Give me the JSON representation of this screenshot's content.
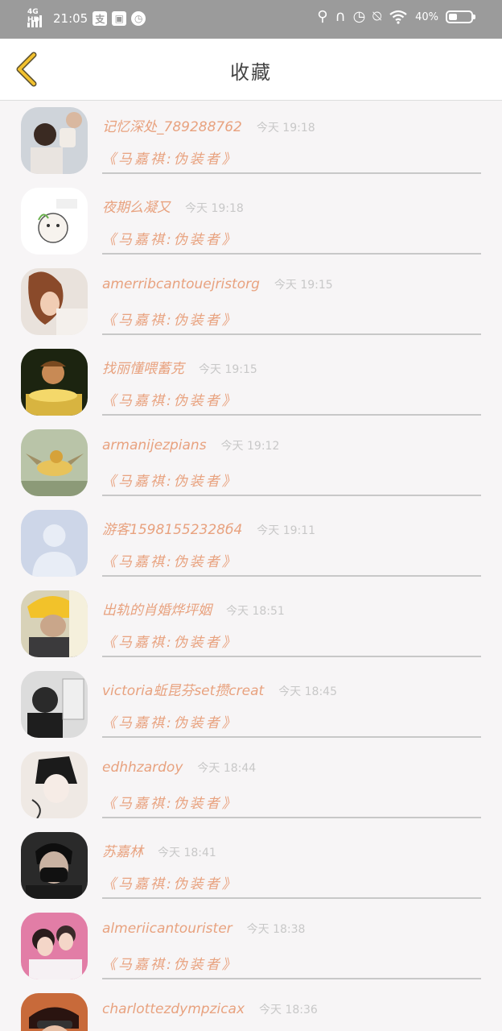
{
  "status_bar": {
    "network": "4G HD",
    "time": "21:05",
    "battery": "40%",
    "battery_level": 0.4,
    "left_icons": [
      "signal-icon",
      "app-notification-icon",
      "photo-notification-icon",
      "alarm-icon"
    ],
    "right_icons": [
      "location-icon",
      "headphones-icon",
      "alarm-icon",
      "mute-icon",
      "wifi-icon",
      "battery-icon"
    ]
  },
  "header": {
    "title": "收藏",
    "back_icon": "chevron-left-icon",
    "accent_color": "#f2c12e"
  },
  "colors": {
    "name_text": "#e8a27f",
    "time_text": "#c8c8c8",
    "divider": "#c8c8c8",
    "status_bar_bg": "#9b9b9b"
  },
  "items": [
    {
      "username": "记忆深处_789288762",
      "time": "今天 19:18",
      "content": "《马嘉祺:伪装者》"
    },
    {
      "username": "夜期么凝又",
      "time": "今天 19:18",
      "content": "《马嘉祺:伪装者》"
    },
    {
      "username": "amerribcantouejristorg",
      "time": "今天 19:15",
      "content": "《马嘉祺:伪装者》"
    },
    {
      "username": "找丽懂喂蓄克",
      "time": "今天 19:15",
      "content": "《马嘉祺:伪装者》"
    },
    {
      "username": "armanijezpians",
      "time": "今天 19:12",
      "content": "《马嘉祺:伪装者》"
    },
    {
      "username": "游客15981552328б4",
      "time": "今天 19:11",
      "content": "《马嘉祺:伪装者》"
    },
    {
      "username": "出轨的肖婚烨坪姻",
      "time": "今天 18:51",
      "content": "《马嘉祺:伪装者》"
    },
    {
      "username": "victoria蚯昆芬set攒creat",
      "time": "今天 18:45",
      "content": "《马嘉祺:伪装者》"
    },
    {
      "username": "edhhzardoy",
      "time": "今天 18:44",
      "content": "《马嘉祺:伪装者》"
    },
    {
      "username": "苏嘉林",
      "time": "今天 18:41",
      "content": "《马嘉祺:伪装者》"
    },
    {
      "username": "almeriicantourister",
      "time": "今天 18:38",
      "content": "《马嘉祺:伪装者》"
    },
    {
      "username": "charlottezdympzicax",
      "time": "今天 18:36",
      "content": ""
    }
  ]
}
